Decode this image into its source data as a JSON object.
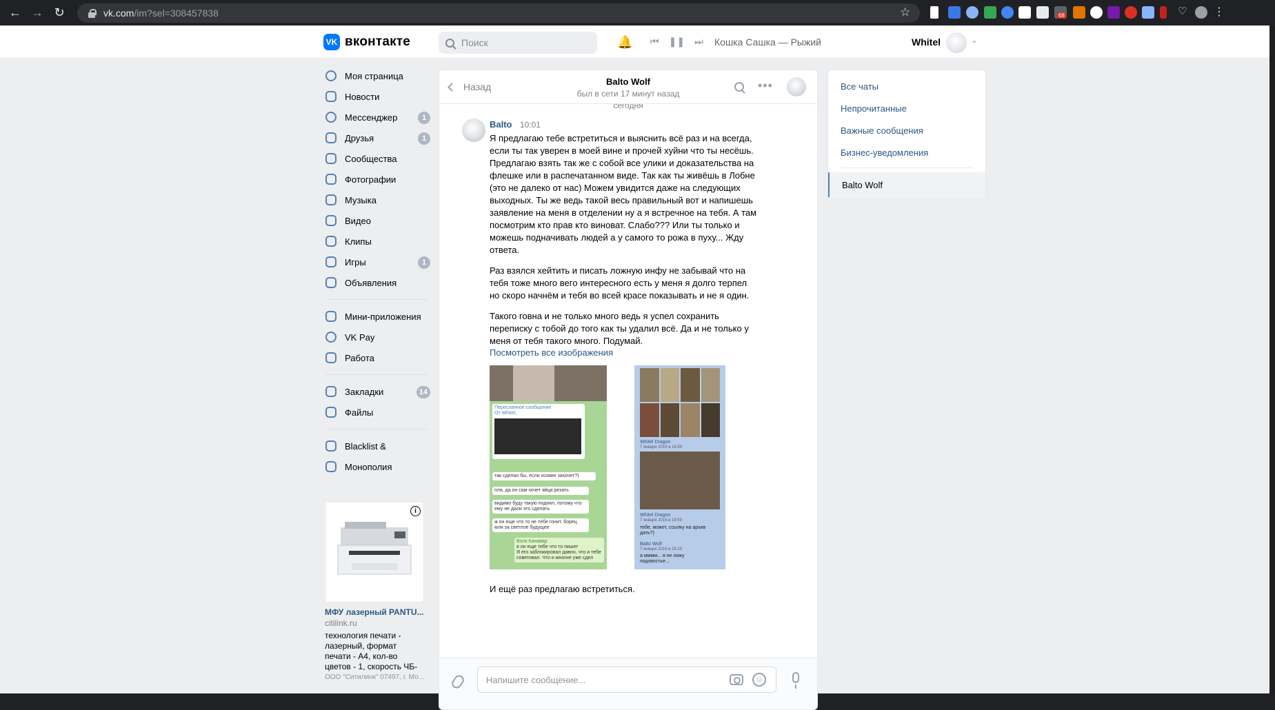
{
  "browser": {
    "url_domain": "vk.com",
    "url_path": "/im?sel=308457838",
    "ext_badge": "68"
  },
  "header": {
    "logo_text": "вконтакте",
    "search_placeholder": "Поиск",
    "now_playing": "Кошка Сашка — Рыжий",
    "user_name": "Whitel"
  },
  "sidebar": {
    "items": [
      {
        "label": "Моя страница",
        "icon": "user-circle-icon"
      },
      {
        "label": "Новости",
        "icon": "news-icon"
      },
      {
        "label": "Мессенджер",
        "icon": "message-icon",
        "badge": "1"
      },
      {
        "label": "Друзья",
        "icon": "friends-icon",
        "badge": "1"
      },
      {
        "label": "Сообщества",
        "icon": "communities-icon"
      },
      {
        "label": "Фотографии",
        "icon": "photo-icon"
      },
      {
        "label": "Музыка",
        "icon": "music-icon"
      },
      {
        "label": "Видео",
        "icon": "video-icon"
      },
      {
        "label": "Клипы",
        "icon": "clips-icon"
      },
      {
        "label": "Игры",
        "icon": "games-icon",
        "badge": "1"
      },
      {
        "label": "Объявления",
        "icon": "ads-icon"
      }
    ],
    "items2": [
      {
        "label": "Мини-приложения",
        "icon": "apps-icon"
      },
      {
        "label": "VK Pay",
        "icon": "vkpay-icon"
      },
      {
        "label": "Работа",
        "icon": "work-icon"
      }
    ],
    "items3": [
      {
        "label": "Закладки",
        "icon": "star-icon",
        "badge": "14"
      },
      {
        "label": "Файлы",
        "icon": "file-icon"
      }
    ],
    "items4": [
      {
        "label": "Blacklist &",
        "icon": "apps-icon"
      },
      {
        "label": "Монополия",
        "icon": "games-icon"
      }
    ]
  },
  "ad": {
    "title": "МФУ лазерный PANTU...",
    "site": "citilink.ru",
    "description": "технология печати - лазерный, формат печати - А4, кол-во цветов - 1, скорость ЧБ-",
    "legal": "ООО \"Ситилинк\" 07497, г. Мо..."
  },
  "chat": {
    "back_label": "Назад",
    "peer_name": "Balto Wolf",
    "peer_status": "был в сети 17 минут назад",
    "date_separator": "сегодня",
    "message": {
      "author": "Balto",
      "time": "10:01",
      "paragraphs": [
        "Я предлагаю тебе встретиться и выяснить всё раз и на всегда, если ты так уверен в моей вине и прочей хуйни что ты несёшь. Предлагаю взять так же с собой все улики и доказательства на флешке или в распечатанном виде. Так как ты живёшь в Лобне (это не далеко от нас) Можем увидится даже на следующих выходных. Ты же ведь такой весь правильный вот и напишешь заявление на меня в отделении ну а я встречное на тебя. А там посмотрим кто прав кто виноват. Слабо??? Или ты только и можешь подначивать людей а у самого то рожа в пуху... Жду ответа.",
        "Раз взялся хейтить и писать ложную инфу не забывай что на тебя тоже много вего интересного есть у меня я долго терпел но скоро начнём и тебя во всей красе показывать и не я один.",
        "Такого говна и не только много ведь я успел сохранить переписку с тобой до того как ты удалил всё. Да и не только у меня от тебя такого много. Подумай."
      ],
      "view_all_link": "Посмотреть все изображения",
      "last_line": "И ещё раз предлагаю встретиться.",
      "screenshot1": {
        "forwarded": "Пересланное сообщение",
        "from": "От Whitel,",
        "q1": "так сделал бы, если хозяин захочет?)",
        "q2": "пля, да он сам хочет яйца резать",
        "q3": "видимо буду такую поднял, потому что ему не дали это сделать",
        "q4": "ж он еще что то не тебе гонит. борец мля за светлое будущее",
        "reply_author": "Волк Канавар",
        "reply_quote": "я он еще тебе что то пишет",
        "reply_text": "Я его заблокировал давно, что и тебе советовал. Что и многие уже сдел"
      },
      "screenshot2": {
        "name1": "Whitel Dragon",
        "date1": "7 января 2016 в 19:59",
        "name2": "Whitel Dragon",
        "date2": "7 января 2016 в 19:59",
        "text2": "тебе, может, ссылку на архив дать?)",
        "name3": "Balto Wolf",
        "date3": "7 января 2016 в 19:19",
        "text3": "а мммм... я не лижу подхвостье..."
      }
    },
    "compose_placeholder": "Напишите сообщение..."
  },
  "right_panel": {
    "filters": [
      "Все чаты",
      "Непрочитанные",
      "Важные сообщения",
      "Бизнес-уведомления"
    ],
    "active_chat": "Balto Wolf"
  }
}
